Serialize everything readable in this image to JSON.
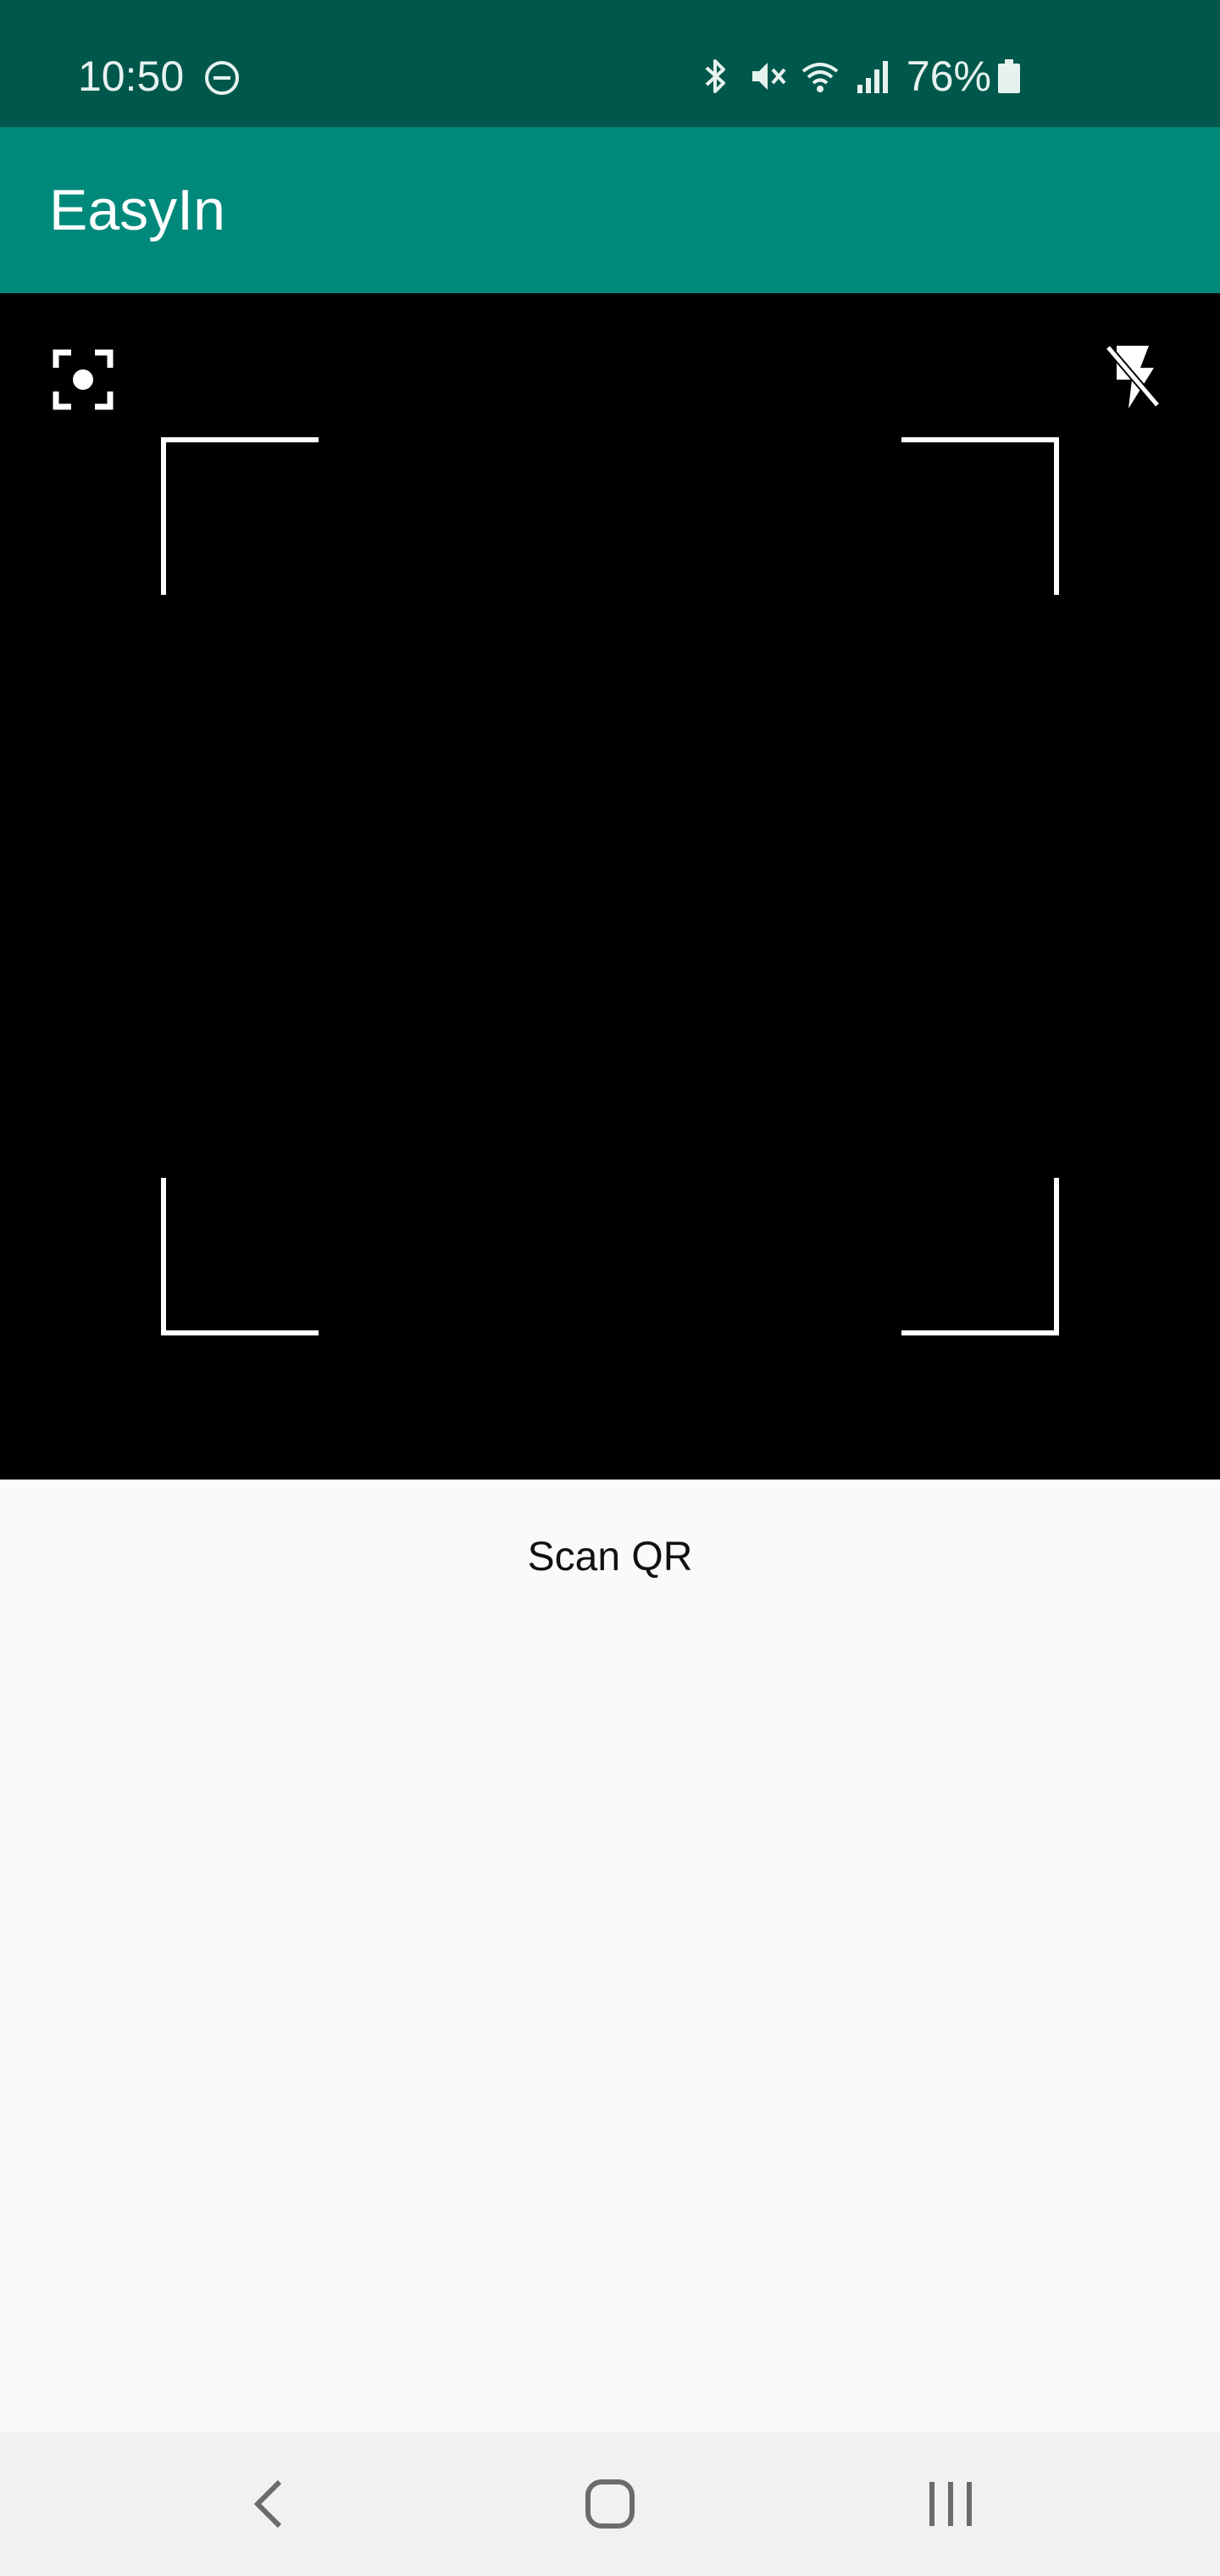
{
  "status_bar": {
    "time": "10:50",
    "battery": "76%",
    "icons": [
      "do-not-disturb-icon",
      "bluetooth-icon",
      "mute-icon",
      "wifi-icon",
      "signal-icon",
      "battery-icon"
    ]
  },
  "app_bar": {
    "title": "EasyIn"
  },
  "scanner": {
    "label": "Scan QR",
    "icons": [
      "focus-icon",
      "flash-off-icon"
    ]
  },
  "nav_bar": {
    "icons": [
      "back-icon",
      "home-icon",
      "recents-icon"
    ]
  },
  "colors": {
    "status_bar": "#00574b",
    "app_bar": "#00897b",
    "camera_bg": "#000000",
    "page_bg": "#fafafa",
    "nav_bg": "#f1f1f1"
  }
}
